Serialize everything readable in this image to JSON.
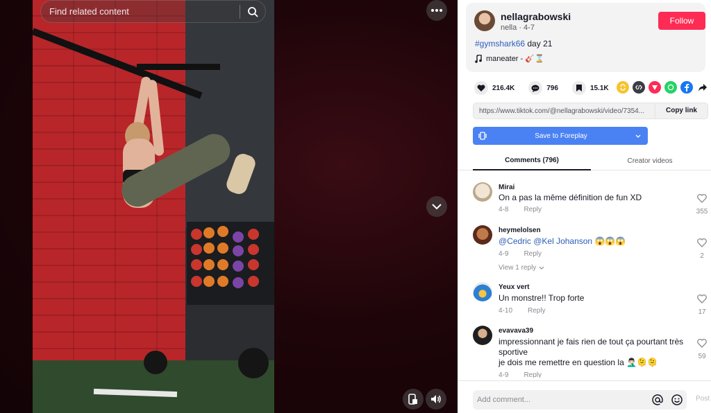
{
  "search": {
    "placeholder": "Find related content"
  },
  "video": {
    "more_icon": "ellipsis-icon",
    "scroll_down_icon": "chevron-down-icon",
    "controls": [
      {
        "name": "picture-in-picture-icon"
      },
      {
        "name": "volume-icon"
      }
    ]
  },
  "author": {
    "username": "nellagrabowski",
    "nickname": "nella",
    "date": "4-7",
    "follow_label": "Follow"
  },
  "post": {
    "hashtag": "#gymshark66",
    "caption_rest": " day 21",
    "music_text": "maneater - 🎸⌛"
  },
  "stats": {
    "likes": "216.4K",
    "comments": "796",
    "saves": "15.1K"
  },
  "share_icons": [
    {
      "name": "repost-icon",
      "color": "#f7c42e"
    },
    {
      "name": "embed-icon",
      "color": "#3c3d44"
    },
    {
      "name": "send-icon",
      "color": "#fe2c55"
    },
    {
      "name": "whatsapp-icon",
      "color": "#25d366"
    },
    {
      "name": "facebook-icon",
      "color": "#1877f2"
    },
    {
      "name": "share-arrow-icon",
      "color": "#161823"
    }
  ],
  "link": {
    "url": "https://www.tiktok.com/@nellagrabowski/video/7354...",
    "copy_label": "Copy link"
  },
  "save_button": {
    "label": "Save to Foreplay"
  },
  "tabs": {
    "comments": "Comments (796)",
    "creator": "Creator videos"
  },
  "comments": [
    {
      "user": "Mirai",
      "text": "On a pas la même définition de fun XD",
      "date": "4-8",
      "reply": "Reply",
      "likes": "355"
    },
    {
      "user": "heymelolsen",
      "mention1": "@Cedric",
      "mention2": "@Kel Johanson",
      "text_suffix": " 😱😱😱",
      "date": "4-9",
      "reply": "Reply",
      "likes": "2",
      "view_replies": "View 1 reply"
    },
    {
      "user": "Yeux vert",
      "text": "Un monstre!! Trop forte",
      "date": "4-10",
      "reply": "Reply",
      "likes": "17"
    },
    {
      "user": "evavava39",
      "text_line1": "impressionnant je fais rien de tout ça pourtant très",
      "text_line2": "sportive",
      "text_line3": "je dois me remettre en question la 🤦🏻‍♂️🫠🫠",
      "date": "4-9",
      "reply": "Reply",
      "likes": "59"
    }
  ],
  "composer": {
    "placeholder": "Add comment...",
    "post_label": "Post"
  }
}
